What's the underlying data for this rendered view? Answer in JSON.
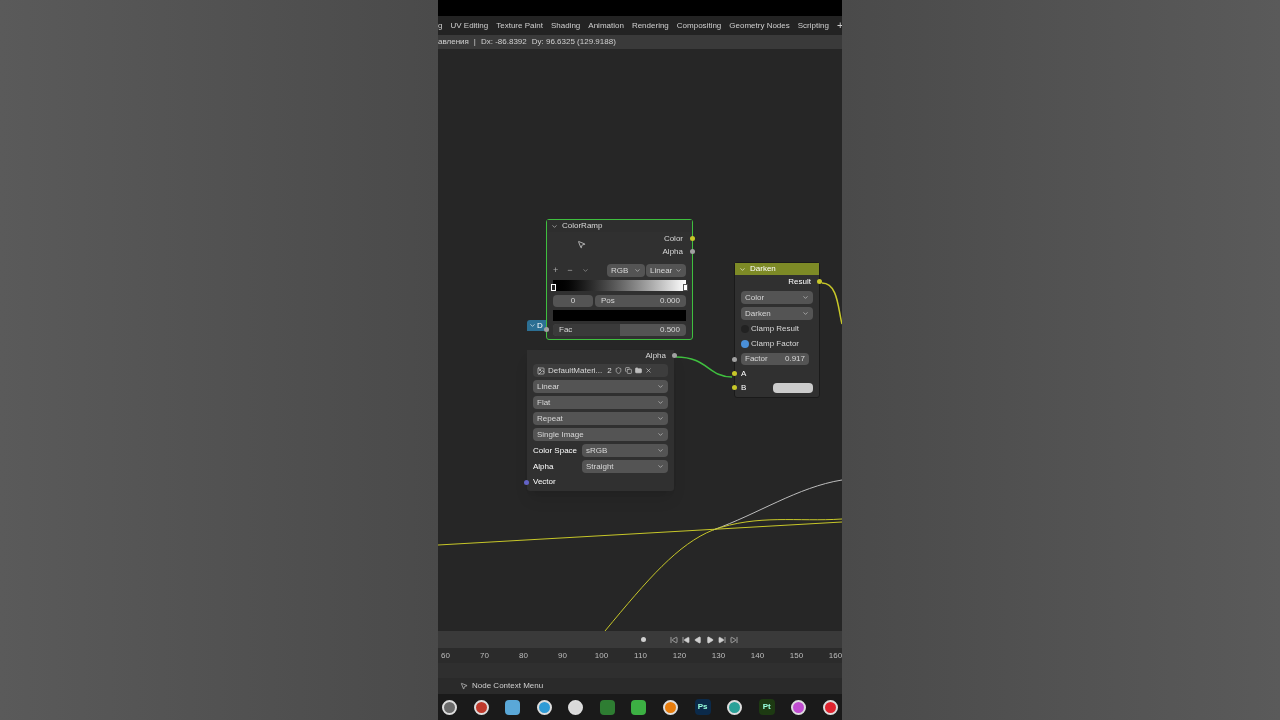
{
  "workspace_tabs": [
    {
      "label": "g"
    },
    {
      "label": "UV Editing"
    },
    {
      "label": "Texture Paint"
    },
    {
      "label": "Shading"
    },
    {
      "label": "Animation"
    },
    {
      "label": "Rendering"
    },
    {
      "label": "Compositing"
    },
    {
      "label": "Geometry Nodes"
    },
    {
      "label": "Scripting"
    },
    {
      "label": "+"
    }
  ],
  "header_status": [
    "авления",
    "|",
    "Dx: -86.8392",
    "Dy: 96.6325 (129.9188)"
  ],
  "image_node": {
    "title": "D",
    "output": "Alpha",
    "image_name": "DefaultMateri...",
    "users": "2",
    "dropdowns": [
      "Linear",
      "Flat",
      "Repeat",
      "Single Image"
    ],
    "fields": [
      {
        "label": "Color Space",
        "value": "sRGB"
      },
      {
        "label": "Alpha",
        "value": "Straight"
      }
    ],
    "input": "Vector"
  },
  "colorramp_node": {
    "title": "ColorRamp",
    "selected": true,
    "outputs": [
      "Color",
      "Alpha"
    ],
    "ops": [
      "+",
      "−"
    ],
    "color_mode": "RGB",
    "interpolation": "Linear",
    "stop_index": "0",
    "pos_label": "Pos",
    "pos_value": "0.000",
    "fac": {
      "label": "Fac",
      "value": "0.500",
      "level": 0.5
    }
  },
  "darken_node": {
    "title": "Darken",
    "selected": false,
    "output": "Result",
    "dropdowns": [
      "Color",
      "Darken"
    ],
    "checkboxes": [
      {
        "label": "Clamp Result",
        "checked": false
      },
      {
        "label": "Clamp Factor",
        "checked": true
      }
    ],
    "factor_label": "Factor",
    "factor_value": "0.917",
    "inputs": [
      "A",
      "B"
    ]
  },
  "timeline": {
    "frames": [
      "60",
      "70",
      "80",
      "90",
      "100",
      "110",
      "120",
      "130",
      "140",
      "150",
      "160"
    ]
  },
  "status_bar": {
    "hint": "Node Context Menu"
  },
  "taskbar": [
    {
      "kind": "skull",
      "color": "#6b6b6b"
    },
    {
      "kind": "gauge",
      "color": "#c0392b"
    },
    {
      "kind": "chat",
      "color": "#5aa8d8"
    },
    {
      "kind": "plane",
      "color": "#2f9bd6"
    },
    {
      "kind": "camera",
      "color": "#d9d9d9"
    },
    {
      "kind": "leaf",
      "color": "#2e7d32"
    },
    {
      "kind": "mountain",
      "color": "#3cb043"
    },
    {
      "kind": "blender",
      "color": "#e87d0d"
    },
    {
      "kind": "text",
      "color": "#0b2a4a",
      "label": "Ps"
    },
    {
      "kind": "wave",
      "color": "#2aa198"
    },
    {
      "kind": "text",
      "color": "#1d3a12",
      "label": "Pt"
    },
    {
      "kind": "swirl",
      "color": "#c04dd0"
    },
    {
      "kind": "ring",
      "color": "#e0242f"
    }
  ]
}
